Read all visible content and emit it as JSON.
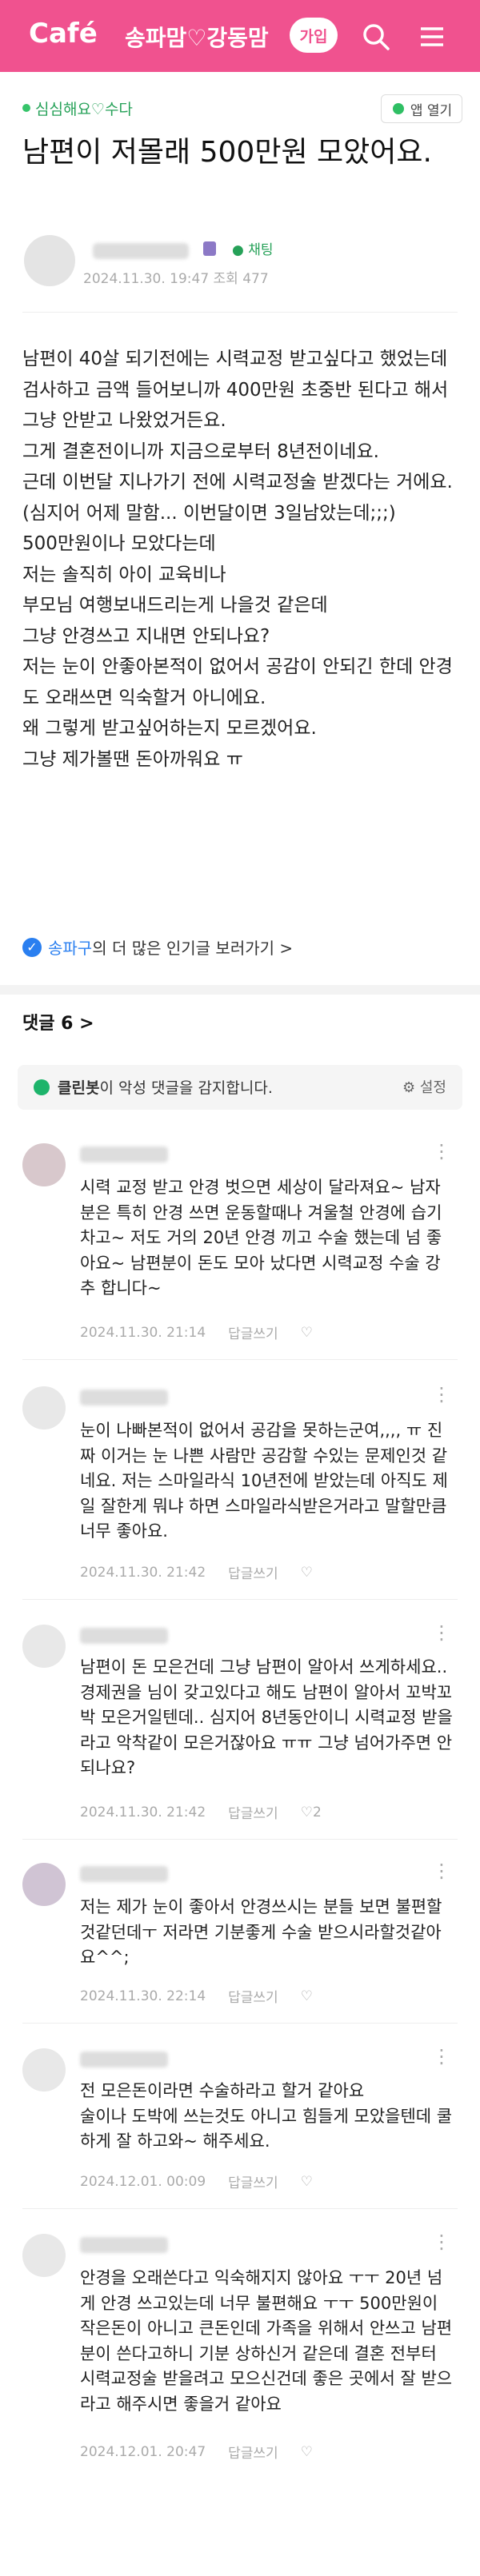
{
  "header": {
    "logo": "Café",
    "cafe_name": "송파맘♡강동맘",
    "join_label": "가입",
    "search_icon": "search-icon",
    "menu_icon": "menu-icon"
  },
  "post": {
    "category": "심심해요♡수다",
    "app_open": "앱 열기",
    "title": "남편이 저몰래 500만원 모았어요.",
    "chat_label": "채팅",
    "meta": "2024.11.30. 19:47 조회 477",
    "body": "남편이 40살 되기전에는 시력교정 받고싶다고 했었는데\n검사하고 금액 들어보니까 400만원 초중반 된다고 해서\n 그냥 안받고 나왔었거든요.\n그게 결혼전이니까 지금으로부터 8년전이네요.\n근데 이번달 지나가기 전에 시력교정술 받겠다는 거에요.\n(심지어 어제 말함... 이번달이면 3일남았는데;;;)\n500만원이나 모았다는데\n저는 솔직히 아이 교육비나\n 부모님 여행보내드리는게 나을것 같은데\n그냥 안경쓰고 지내면 안되나요?\n저는 눈이 안좋아본적이 없어서 공감이 안되긴 한데 안경도 오래쓰면 익숙할거 아니에요.\n왜 그렇게 받고싶어하는지 모르겠어요.\n그냥 제가볼땐 돈아까워요 ㅠ",
    "more_link": "송파구",
    "more_rest": "의 더 많은 인기글 보러가기 >"
  },
  "comments_header": {
    "label": "댓글 6 >"
  },
  "cleanbot": {
    "name": "클린봇",
    "text": "이 악성 댓글을 감지합니다.",
    "setting": "설정"
  },
  "comments": [
    {
      "text": "시력 교정 받고 안경 벗으면 세상이 달라져요~ 남자분은 특히 안경 쓰면 운동할때나 겨울철 안경에 습기차고~ 저도 거의 20년 안경 끼고 수술 했는데 넘 좋아요~ 남편분이 돈도 모아 났다면 시력교정 수술 강추 합니다~",
      "date": "2024.11.30. 21:14",
      "reply": "답글쓰기",
      "likes": ""
    },
    {
      "text": "눈이 나빠본적이 없어서 공감을 못하는군여,,,, ㅠ 진짜 이거는 눈 나쁜 사람만 공감할 수있는 문제인것 같네요. 저는 스마일라식 10년전에 받았는데 아직도 제일 잘한게 뭐냐 하면 스마일라식받은거라고 말할만큼 너무 좋아요.",
      "date": "2024.11.30. 21:42",
      "reply": "답글쓰기",
      "likes": ""
    },
    {
      "text": "남편이 돈 모은건데 그냥 남편이 알아서 쓰게하세요.. 경제권을 님이 갖고있다고 해도 남편이 알아서 꼬박꼬박 모은거일텐데.. 심지어 8년동안이니 시력교정 받을라고 악착같이 모은거잖아요 ㅠㅠ 그냥 넘어가주면 안되나요?",
      "date": "2024.11.30. 21:42",
      "reply": "답글쓰기",
      "likes": "2"
    },
    {
      "text": "저는 제가 눈이 좋아서 안경쓰시는 분들 보면 불편할것같던데ㅜ 저라면 기분좋게 수술 받으시라할것같아요^^;",
      "date": "2024.11.30. 22:14",
      "reply": "답글쓰기",
      "likes": ""
    },
    {
      "text": "전 모은돈이라면 수술하라고 할거 같아요\n술이나 도박에 쓰는것도 아니고 힘들게 모았을텐데 쿨하게 잘 하고와~ 해주세요.",
      "date": "2024.12.01. 00:09",
      "reply": "답글쓰기",
      "likes": ""
    },
    {
      "text": "안경을 오래쓴다고 익숙해지지 않아요 ㅜㅜ 20년 넘게 안경 쓰고있는데 너무 불편해요 ㅜㅜ 500만원이 작은돈이 아니고 큰돈인데 가족을 위해서 안쓰고 남편분이 쓴다고하니 기분 상하신거 같은데 결혼 전부터 시력교정술 받을려고 모으신건데 좋은 곳에서 잘 받으라고 해주시면 좋을거 같아요",
      "date": "2024.12.01. 20:47",
      "reply": "답글쓰기",
      "likes": ""
    }
  ]
}
